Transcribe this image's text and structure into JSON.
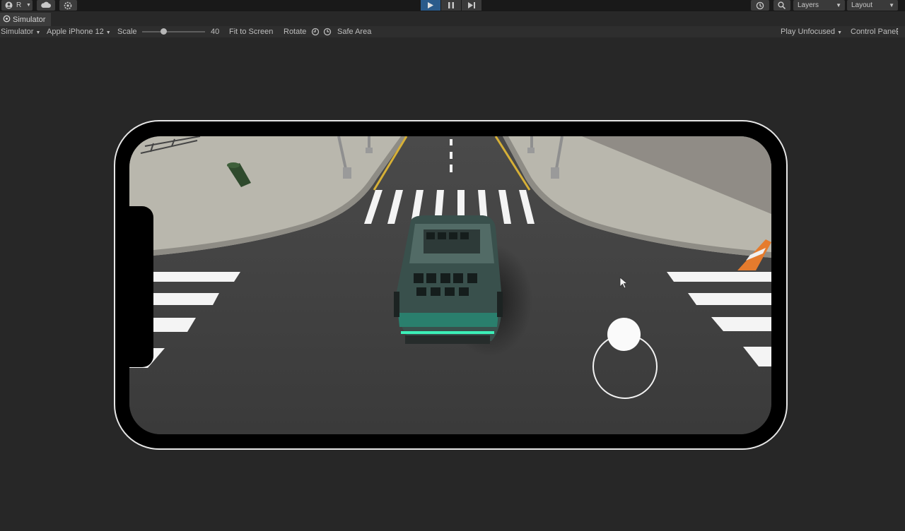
{
  "toolbar": {
    "account_initial": "R",
    "layers_label": "Layers",
    "layout_label": "Layout"
  },
  "window": {
    "tab_title": "Simulator"
  },
  "sim_controls": {
    "mode": "Simulator",
    "device": "Apple iPhone 12",
    "scale_label": "Scale",
    "scale_value": "40",
    "fit_to_screen": "Fit to Screen",
    "rotate": "Rotate",
    "safe_area": "Safe Area",
    "play_mode": "Play Unfocused",
    "control_panel": "Control Panel"
  },
  "colors": {
    "editor_bg": "#272727",
    "play_active": "#2b5b8b",
    "device_frame": "#e6e6e6"
  },
  "icons": [
    "account-icon",
    "cloud-icon",
    "settings-icon",
    "play-icon",
    "pause-icon",
    "step-icon",
    "history-icon",
    "search-icon",
    "simulator-icon",
    "rotate-left-icon",
    "rotate-right-icon",
    "kebab-menu-icon"
  ]
}
